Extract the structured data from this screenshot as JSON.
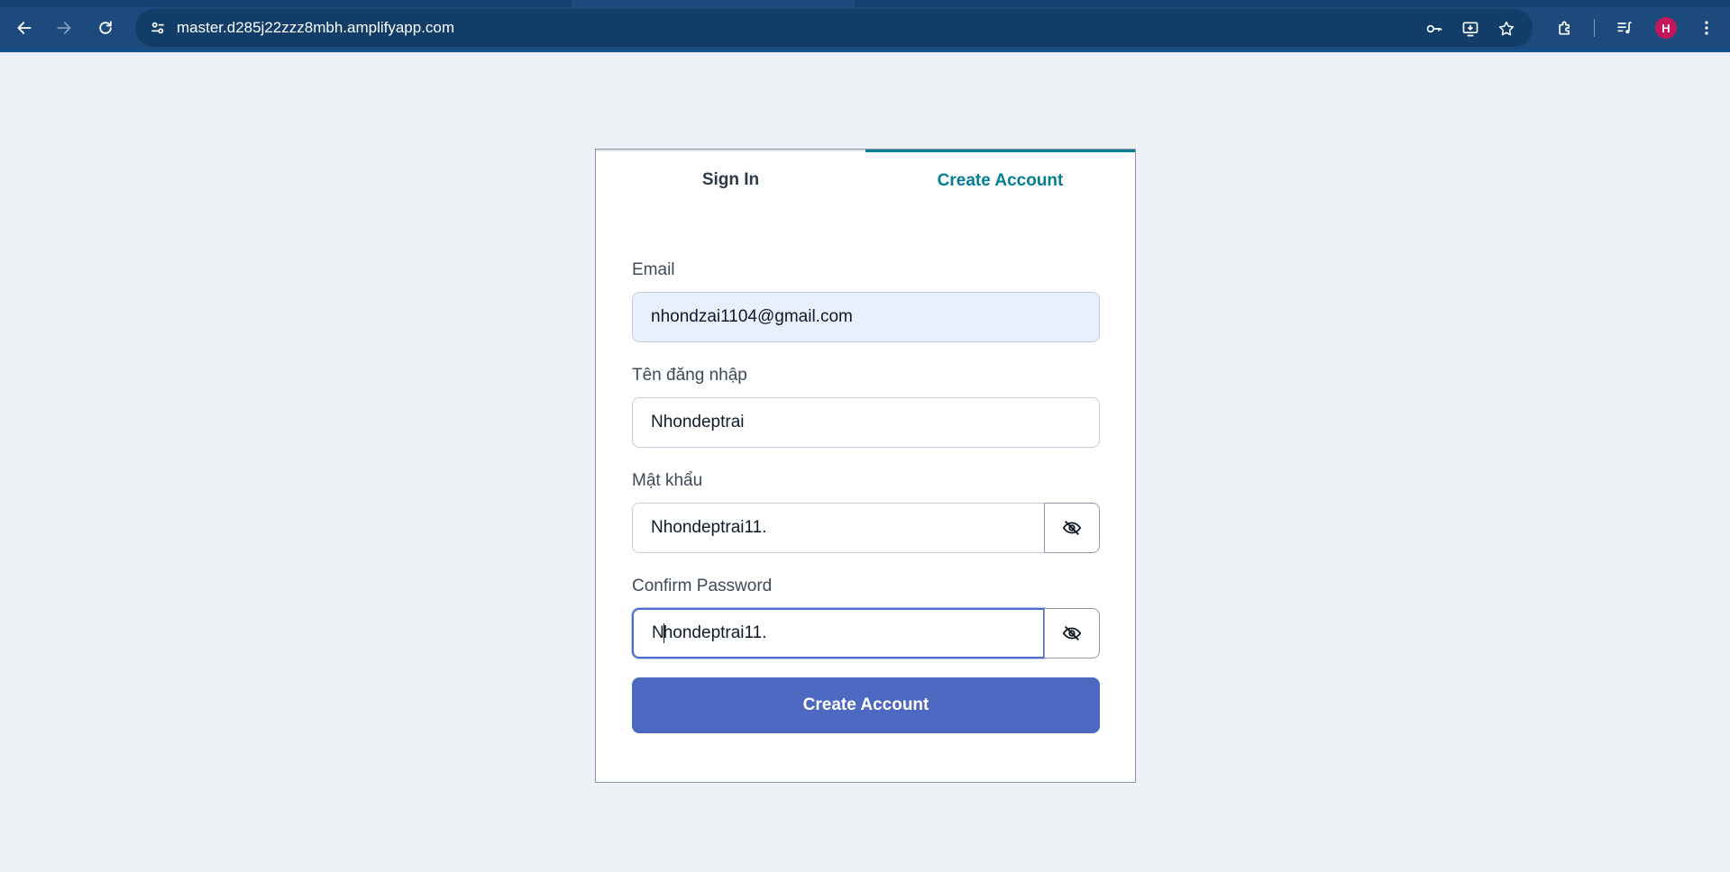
{
  "browser": {
    "url": "master.d285j22zzz8mbh.amplifyapp.com",
    "profile_initial": "H",
    "colors": {
      "toolbar": "#1c4a7c",
      "omnibox": "#123d69",
      "avatar": "#c2185b"
    }
  },
  "auth": {
    "tabs": {
      "sign_in": "Sign In",
      "create_account": "Create Account"
    },
    "fields": {
      "email": {
        "label": "Email",
        "value": "nhondzai1104@gmail.com"
      },
      "username": {
        "label": "Tên đăng nhập",
        "value": "Nhondeptrai"
      },
      "password": {
        "label": "Mật khẩu",
        "value": "Nhondeptrai11."
      },
      "confirm_password": {
        "label": "Confirm Password",
        "value_before_caret": "N",
        "value_after_caret": "hondeptrai11."
      }
    },
    "submit_label": "Create Account",
    "colors": {
      "accent": "#047d95",
      "button": "#4c68c0",
      "focus": "#4c6fd0"
    }
  }
}
